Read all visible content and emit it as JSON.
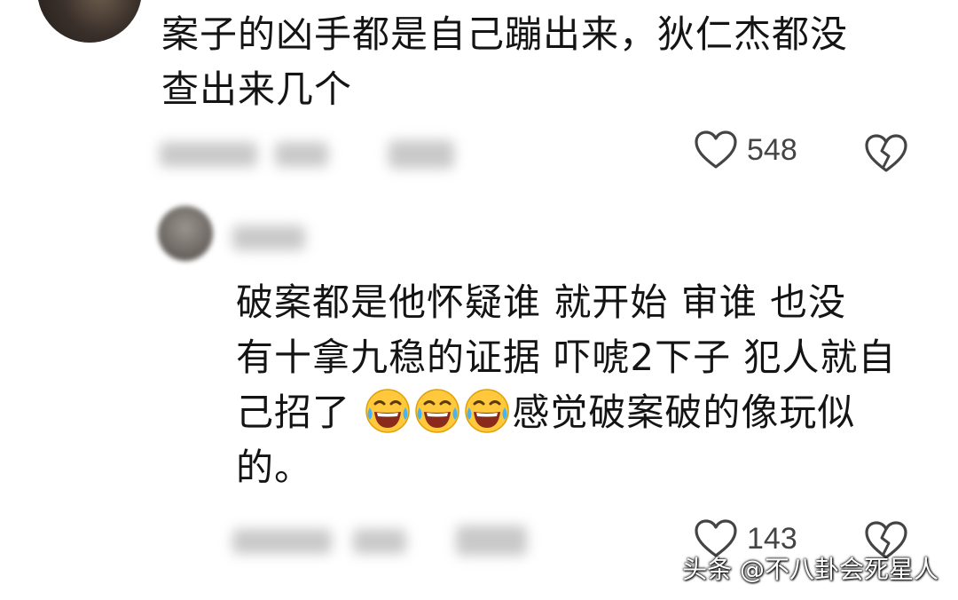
{
  "comments": [
    {
      "text_line1": "案子的凶手都是自己蹦出来，狄仁杰都没",
      "text_line2": "查出来几个",
      "likes": "548",
      "like_icon": "heart-outline-icon",
      "dislike_icon": "broken-heart-icon"
    },
    {
      "text_line1": "破案都是他怀疑谁   就开始 审谁 也没",
      "text_line2": "有十拿九稳的证据 吓唬2下子 犯人就自",
      "text_line3_a": "己招了",
      "emojis": [
        "laughing-crying-emoji",
        "laughing-crying-emoji",
        "laughing-crying-emoji"
      ],
      "text_line3_b": "感觉破案破的像玩似",
      "text_line4": "的。",
      "likes": "143",
      "like_icon": "heart-outline-icon",
      "dislike_icon": "broken-heart-icon"
    }
  ],
  "watermark": "头条 @不八卦会死星人",
  "colors": {
    "icon_gray": "#444444",
    "emoji_yellow": "#FFC83D"
  }
}
